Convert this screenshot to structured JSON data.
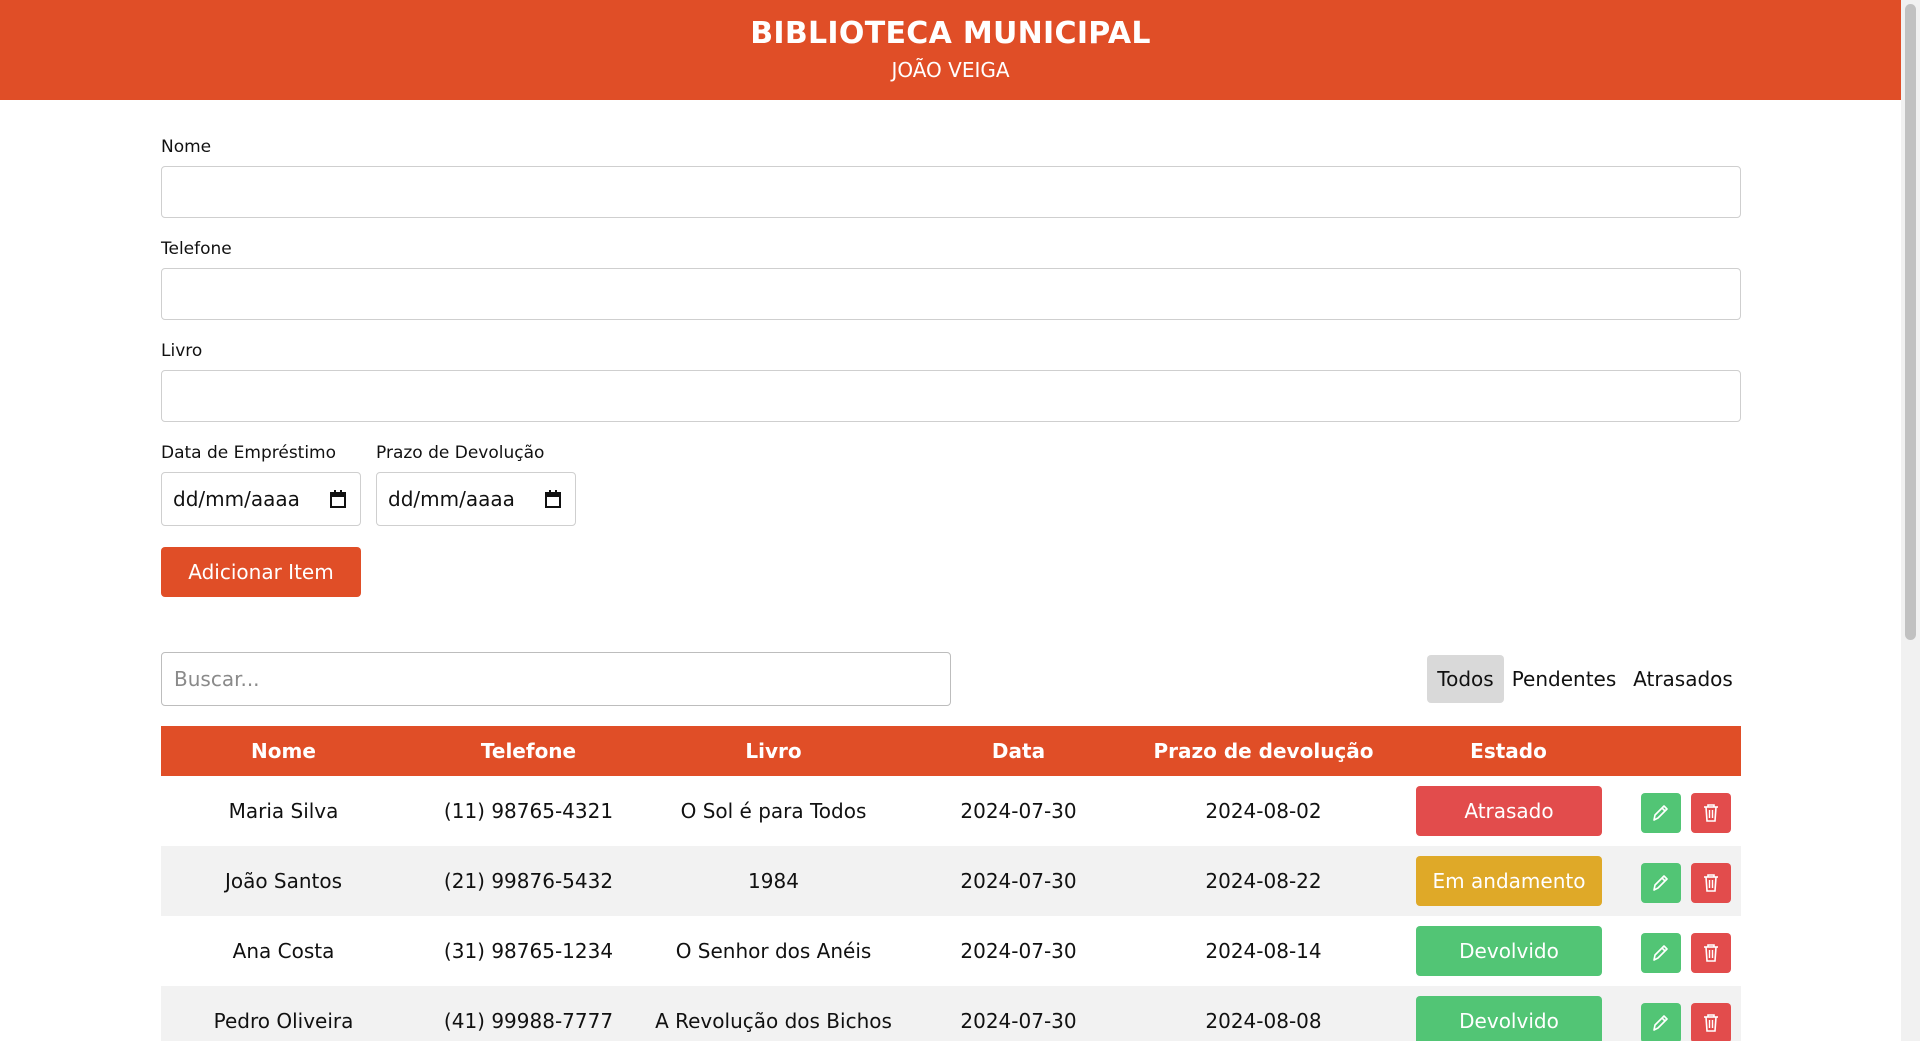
{
  "header": {
    "title": "BIBLIOTECA MUNICIPAL",
    "subtitle": "JOÃO VEIGA"
  },
  "form": {
    "nome_label": "Nome",
    "telefone_label": "Telefone",
    "livro_label": "Livro",
    "data_emprestimo_label": "Data de Empréstimo",
    "prazo_devolucao_label": "Prazo de Devolução",
    "data_emprestimo_value": "dd/mm/aaaa",
    "prazo_devolucao_value": "dd/mm/aaaa",
    "submit_label": "Adicionar Item"
  },
  "search": {
    "placeholder": "Buscar..."
  },
  "filters": [
    {
      "label": "Todos",
      "active": true
    },
    {
      "label": "Pendentes",
      "active": false
    },
    {
      "label": "Atrasados",
      "active": false
    }
  ],
  "table": {
    "columns": [
      "Nome",
      "Telefone",
      "Livro",
      "Data",
      "Prazo de devolução",
      "Estado"
    ],
    "rows": [
      {
        "nome": "Maria Silva",
        "telefone": "(11) 98765-4321",
        "livro": "O Sol é para Todos",
        "data": "2024-07-30",
        "prazo": "2024-08-02",
        "estado": "Atrasado"
      },
      {
        "nome": "João Santos",
        "telefone": "(21) 99876-5432",
        "livro": "1984",
        "data": "2024-07-30",
        "prazo": "2024-08-22",
        "estado": "Em andamento"
      },
      {
        "nome": "Ana Costa",
        "telefone": "(31) 98765-1234",
        "livro": "O Senhor dos Anéis",
        "data": "2024-07-30",
        "prazo": "2024-08-14",
        "estado": "Devolvido"
      },
      {
        "nome": "Pedro Oliveira",
        "telefone": "(41) 99988-7777",
        "livro": "A Revolução dos Bichos",
        "data": "2024-07-30",
        "prazo": "2024-08-08",
        "estado": "Devolvido"
      }
    ]
  },
  "icons": {
    "calendar": "calendar-icon",
    "edit": "pencil-icon",
    "delete": "trash-icon"
  },
  "colors": {
    "brand": "#e04e27",
    "atrasado": "#e24c4c",
    "em_andamento": "#dfa928",
    "devolvido": "#52c575",
    "edit": "#52c575",
    "delete": "#e24c4c"
  }
}
